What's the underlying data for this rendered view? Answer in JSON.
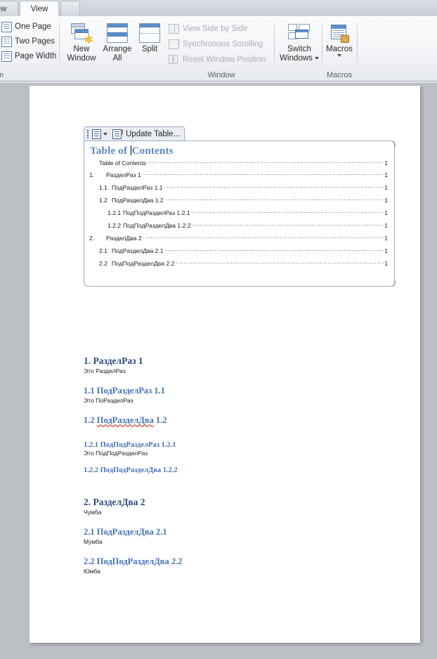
{
  "ribbon": {
    "tabs": [
      {
        "label": "ew",
        "active": false,
        "partial": true
      },
      {
        "label": "View",
        "active": true,
        "partial": false
      }
    ],
    "zoom_group": {
      "label": "m",
      "items": [
        {
          "label": "One Page",
          "icon": "one-page-icon"
        },
        {
          "label": "Two Pages",
          "icon": "two-pages-icon"
        },
        {
          "label": "Page Width",
          "icon": "page-width-icon"
        }
      ]
    },
    "window_group": {
      "label": "Window",
      "big_buttons": [
        {
          "label_line1": "New",
          "label_line2": "Window",
          "icon": "new-window-icon"
        },
        {
          "label_line1": "Arrange",
          "label_line2": "All",
          "icon": "arrange-all-icon"
        },
        {
          "label_line1": "Split",
          "label_line2": "",
          "icon": "split-icon"
        }
      ],
      "small_commands": [
        {
          "label": "View Side by Side",
          "icon": "view-side-by-side-icon",
          "disabled": true
        },
        {
          "label": "Synchronous Scrolling",
          "icon": "synchronous-scrolling-icon",
          "disabled": true
        },
        {
          "label": "Reset Window Position",
          "icon": "reset-window-position-icon",
          "disabled": true
        }
      ],
      "switch_windows": {
        "label_line1": "Switch",
        "label_line2": "Windows",
        "icon": "switch-windows-icon",
        "has_dropdown": true
      }
    },
    "macros_group": {
      "label": "Macros",
      "button": {
        "label_line1": "Macros",
        "label_line2": "",
        "icon": "macros-icon",
        "has_dropdown": true
      }
    }
  },
  "toc_control": {
    "toolbar": {
      "handle": "content-control-handle",
      "doc_icon": "toc-options-icon",
      "dropdown_caret": "chevron-down-icon",
      "update_icon": "update-table-icon",
      "update_label": "Update Table..."
    },
    "title_before_caret": "Table of ",
    "title_after_caret": "Contents",
    "entries": [
      {
        "level": 0,
        "number": "",
        "text": "Table of Contents",
        "page": "1"
      },
      {
        "level": 1,
        "number": "1.",
        "text": "РазделРаз 1",
        "page": "1"
      },
      {
        "level": 2,
        "number": "1.1",
        "text": "ПодРазделРаз 1.1",
        "page": "1"
      },
      {
        "level": 2,
        "number": "1.2",
        "text": "ПодРазделДва 1.2",
        "page": "1"
      },
      {
        "level": 3,
        "number": "1.2.1",
        "text": "ПодПодРазделРаз  1.2.1",
        "page": "1"
      },
      {
        "level": 3,
        "number": "1.2.2",
        "text": "ПодПодРазделДва 1.2.2",
        "page": "1"
      },
      {
        "level": 1,
        "number": "2.",
        "text": "РазделДва 2",
        "page": "1"
      },
      {
        "level": 2,
        "number": "2.1",
        "text": "ПодРазделДва 2.1",
        "page": "1"
      },
      {
        "level": 2,
        "number": "2.2",
        "text": "ПодПодРазделДва 2.2",
        "page": "1"
      }
    ]
  },
  "document": {
    "sections": [
      {
        "style": "h1",
        "heading": "1.  РазделРаз 1",
        "body": "Это РазделРаз"
      },
      {
        "style": "h2",
        "heading": "1.1   ПодРазделРаз  1.1",
        "body": "Это ПоРазделРаз"
      },
      {
        "style": "h2",
        "heading_prefix": "1.2   ",
        "heading_spell": "ПодРазделДва",
        "heading_suffix": " 1.2",
        "body": ""
      },
      {
        "style": "h3",
        "heading": "1.2.1   ПодПодРазделРаз   1.2.1",
        "body": "Это ПодПодРазделРаз"
      },
      {
        "style": "h3",
        "heading": "1.2.2   ПодПодРазделДва 1.2.2",
        "body": ""
      },
      {
        "style": "h1",
        "heading": "2.   РазделДва 2",
        "body": "Чумба"
      },
      {
        "style": "h2",
        "heading": "2.1   ПодРазделДва 2.1",
        "body": "Мумба"
      },
      {
        "style": "h2",
        "heading": "2.2   ПодПодРазделДва 2.2",
        "body": "Юмба"
      }
    ]
  },
  "colors": {
    "heading1": "#2a4a7c",
    "heading2": "#4472b8",
    "toc_title": "#5a87c4",
    "canvas": "#bcc0c5",
    "spell_error": "#d64b3e"
  }
}
